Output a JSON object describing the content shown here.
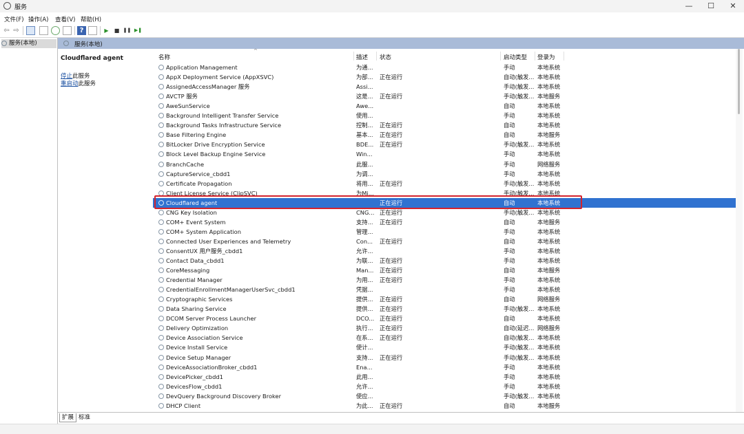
{
  "window": {
    "title": "服务",
    "minimize": "—",
    "maximize": "☐",
    "close": "✕"
  },
  "menu": [
    "文件(F)",
    "操作(A)",
    "查看(V)",
    "帮助(H)"
  ],
  "toolbar": {
    "back": "⇦",
    "forward": "⇨",
    "play": "▶",
    "stop": "■",
    "pause": "❚❚",
    "resume": "▶❚",
    "help": "?"
  },
  "tree": {
    "root_label": "服务(本地)"
  },
  "pane": {
    "header_label": "服务(本地)",
    "selected_service": "Cloudflared agent",
    "stop_link": "停止",
    "stop_suffix": "此服务",
    "restart_link": "重启动",
    "restart_suffix": "此服务"
  },
  "columns": {
    "name": "名称",
    "desc": "描述",
    "status": "状态",
    "startup": "启动类型",
    "logon": "登录为",
    "sort_arrow": "^"
  },
  "rows": [
    {
      "name": "Application Management",
      "desc": "为通...",
      "status": "",
      "startup": "手动",
      "logon": "本地系统"
    },
    {
      "name": "AppX Deployment Service (AppXSVC)",
      "desc": "为部...",
      "status": "正在运行",
      "startup": "自动(触发...",
      "logon": "本地系统"
    },
    {
      "name": "AssignedAccessManager 服务",
      "desc": "Assi...",
      "status": "",
      "startup": "手动(触发...",
      "logon": "本地系统"
    },
    {
      "name": "AVCTP 服务",
      "desc": "这是...",
      "status": "正在运行",
      "startup": "手动(触发...",
      "logon": "本地服务"
    },
    {
      "name": "AweSunService",
      "desc": "Awe...",
      "status": "",
      "startup": "自动",
      "logon": "本地系统"
    },
    {
      "name": "Background Intelligent Transfer Service",
      "desc": "使用...",
      "status": "",
      "startup": "手动",
      "logon": "本地系统"
    },
    {
      "name": "Background Tasks Infrastructure Service",
      "desc": "控制...",
      "status": "正在运行",
      "startup": "自动",
      "logon": "本地系统"
    },
    {
      "name": "Base Filtering Engine",
      "desc": "基本...",
      "status": "正在运行",
      "startup": "自动",
      "logon": "本地服务"
    },
    {
      "name": "BitLocker Drive Encryption Service",
      "desc": "BDE...",
      "status": "正在运行",
      "startup": "手动(触发...",
      "logon": "本地系统"
    },
    {
      "name": "Block Level Backup Engine Service",
      "desc": "Win...",
      "status": "",
      "startup": "手动",
      "logon": "本地系统"
    },
    {
      "name": "BranchCache",
      "desc": "此服...",
      "status": "",
      "startup": "手动",
      "logon": "网络服务"
    },
    {
      "name": "CaptureService_cbdd1",
      "desc": "为调...",
      "status": "",
      "startup": "手动",
      "logon": "本地系统"
    },
    {
      "name": "Certificate Propagation",
      "desc": "将用...",
      "status": "正在运行",
      "startup": "手动(触发...",
      "logon": "本地系统"
    },
    {
      "name": "Client License Service (ClipSVC)",
      "desc": "为Mi...",
      "status": "",
      "startup": "手动(触发...",
      "logon": "本地系统"
    },
    {
      "name": "Cloudflared agent",
      "desc": "",
      "status": "正在运行",
      "startup": "自动",
      "logon": "本地系统",
      "selected": true
    },
    {
      "name": "CNG Key Isolation",
      "desc": "CNG...",
      "status": "正在运行",
      "startup": "手动(触发...",
      "logon": "本地系统"
    },
    {
      "name": "COM+ Event System",
      "desc": "支持...",
      "status": "正在运行",
      "startup": "自动",
      "logon": "本地服务"
    },
    {
      "name": "COM+ System Application",
      "desc": "管理...",
      "status": "",
      "startup": "手动",
      "logon": "本地系统"
    },
    {
      "name": "Connected User Experiences and Telemetry",
      "desc": "Con...",
      "status": "正在运行",
      "startup": "自动",
      "logon": "本地系统"
    },
    {
      "name": "ConsentUX 用户服务_cbdd1",
      "desc": "允许...",
      "status": "",
      "startup": "手动",
      "logon": "本地系统"
    },
    {
      "name": "Contact Data_cbdd1",
      "desc": "为联...",
      "status": "正在运行",
      "startup": "手动",
      "logon": "本地系统"
    },
    {
      "name": "CoreMessaging",
      "desc": "Man...",
      "status": "正在运行",
      "startup": "自动",
      "logon": "本地服务"
    },
    {
      "name": "Credential Manager",
      "desc": "为用...",
      "status": "正在运行",
      "startup": "手动",
      "logon": "本地系统"
    },
    {
      "name": "CredentialEnrollmentManagerUserSvc_cbdd1",
      "desc": "凭据...",
      "status": "",
      "startup": "手动",
      "logon": "本地系统"
    },
    {
      "name": "Cryptographic Services",
      "desc": "提供...",
      "status": "正在运行",
      "startup": "自动",
      "logon": "网络服务"
    },
    {
      "name": "Data Sharing Service",
      "desc": "提供...",
      "status": "正在运行",
      "startup": "手动(触发...",
      "logon": "本地系统"
    },
    {
      "name": "DCOM Server Process Launcher",
      "desc": "DCO...",
      "status": "正在运行",
      "startup": "自动",
      "logon": "本地系统"
    },
    {
      "name": "Delivery Optimization",
      "desc": "执行...",
      "status": "正在运行",
      "startup": "自动(延迟...",
      "logon": "网络服务"
    },
    {
      "name": "Device Association Service",
      "desc": "在系...",
      "status": "正在运行",
      "startup": "自动(触发...",
      "logon": "本地系统"
    },
    {
      "name": "Device Install Service",
      "desc": "使计...",
      "status": "",
      "startup": "手动(触发...",
      "logon": "本地系统"
    },
    {
      "name": "Device Setup Manager",
      "desc": "支持...",
      "status": "正在运行",
      "startup": "手动(触发...",
      "logon": "本地系统"
    },
    {
      "name": "DeviceAssociationBroker_cbdd1",
      "desc": "Ena...",
      "status": "",
      "startup": "手动",
      "logon": "本地系统"
    },
    {
      "name": "DevicePicker_cbdd1",
      "desc": "此用...",
      "status": "",
      "startup": "手动",
      "logon": "本地系统"
    },
    {
      "name": "DevicesFlow_cbdd1",
      "desc": "允许...",
      "status": "",
      "startup": "手动",
      "logon": "本地系统"
    },
    {
      "name": "DevQuery Background Discovery Broker",
      "desc": "使应...",
      "status": "",
      "startup": "手动(触发...",
      "logon": "本地系统"
    },
    {
      "name": "DHCP Client",
      "desc": "为此...",
      "status": "正在运行",
      "startup": "自动",
      "logon": "本地服务"
    }
  ],
  "tabs": [
    "扩展",
    "标准"
  ]
}
